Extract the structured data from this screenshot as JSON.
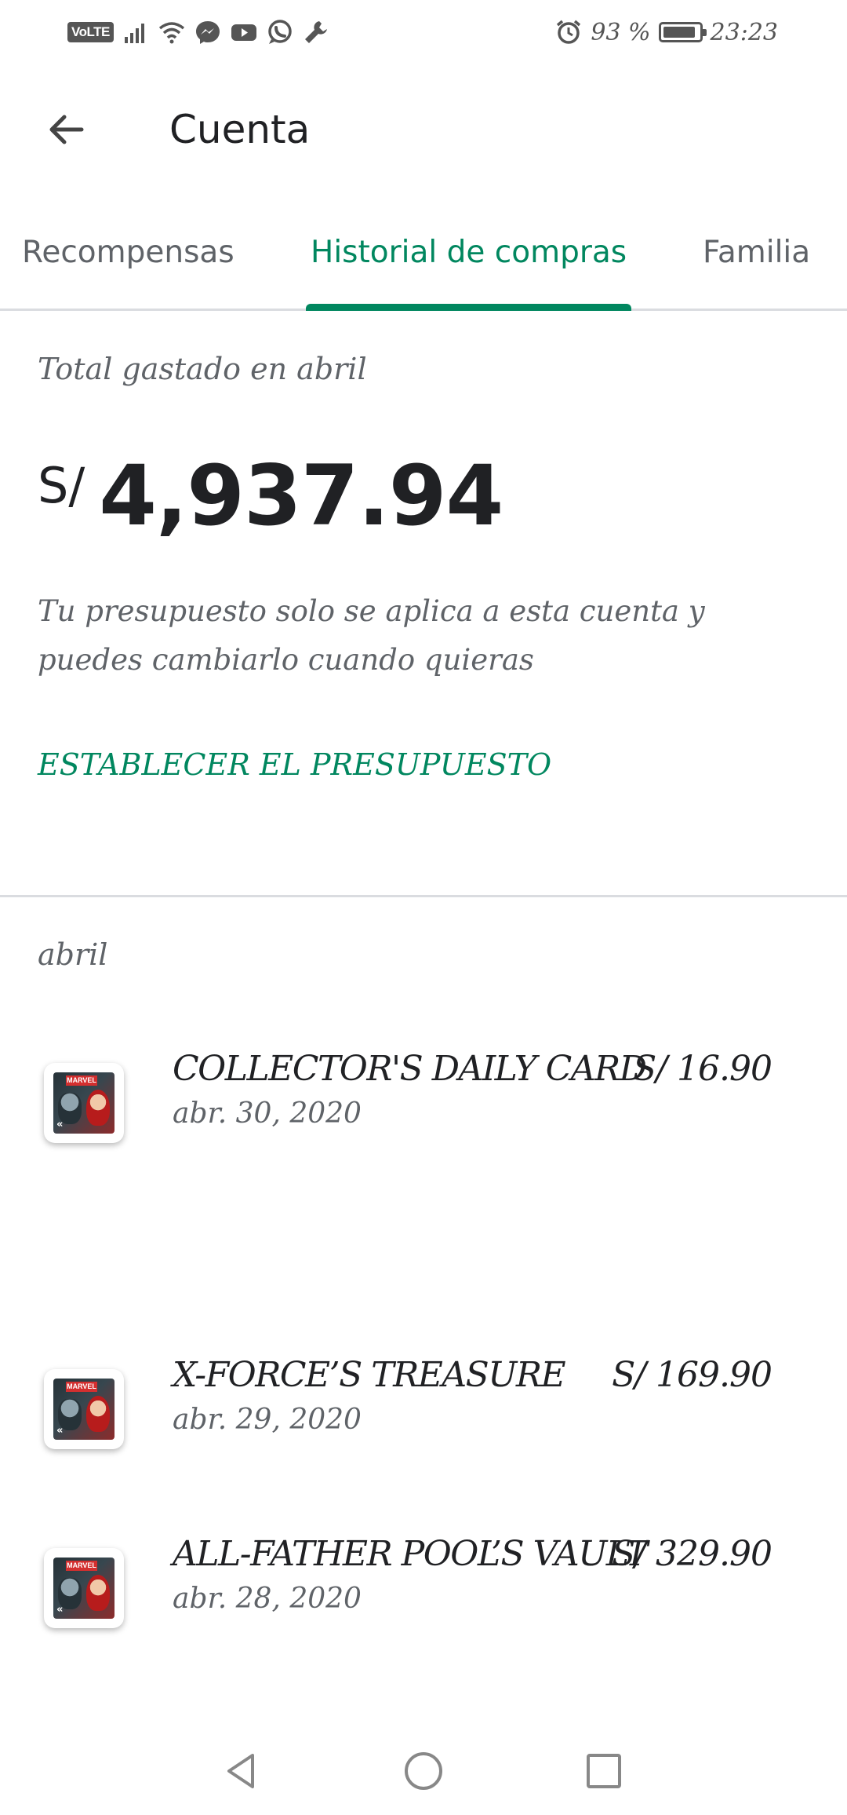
{
  "status_bar": {
    "volte": "VoLTE",
    "battery_percent": "93 %",
    "battery_level": 0.93,
    "time": "23:23",
    "icons": [
      "signal-icon",
      "wifi-icon",
      "messenger-icon",
      "youtube-icon",
      "whatsapp-icon",
      "wrench-icon",
      "alarm-icon",
      "battery-icon"
    ]
  },
  "app_bar": {
    "title": "Cuenta",
    "back_icon": "arrow-left-icon"
  },
  "tabs": [
    {
      "label": "Recompensas",
      "active": false
    },
    {
      "label": "Historial de compras",
      "active": true
    },
    {
      "label": "Familia",
      "active": false
    }
  ],
  "summary": {
    "label": "Total gastado en abril",
    "currency": "S/",
    "amount": "4,937.94",
    "note": "Tu presupuesto solo se aplica a esta cuenta y puedes cambiarlo cuando quieras",
    "set_budget_link": "ESTABLECER EL PRESUPUESTO"
  },
  "purchases": {
    "month": "abril",
    "items": [
      {
        "title": "COLLECTOR'S DAILY CARD",
        "price": "S/ 16.90",
        "date": "abr. 30, 2020",
        "thumb_banner": "MARVEL"
      },
      {
        "title": "X-FORCE’S TREASURE",
        "price": "S/ 169.90",
        "date": "abr. 29, 2020",
        "thumb_banner": "MARVEL"
      },
      {
        "title": "ALL-FATHER POOL’S VAULT",
        "price": "S/ 329.90",
        "date": "abr. 28, 2020",
        "thumb_banner": "MARVEL"
      }
    ]
  },
  "nav_bar": {
    "icons": [
      "back-triangle-icon",
      "home-circle-icon",
      "recents-square-icon"
    ]
  },
  "colors": {
    "accent": "#01875f",
    "text_primary": "#202124",
    "text_secondary": "#5f6368",
    "divider": "#dadce0"
  }
}
